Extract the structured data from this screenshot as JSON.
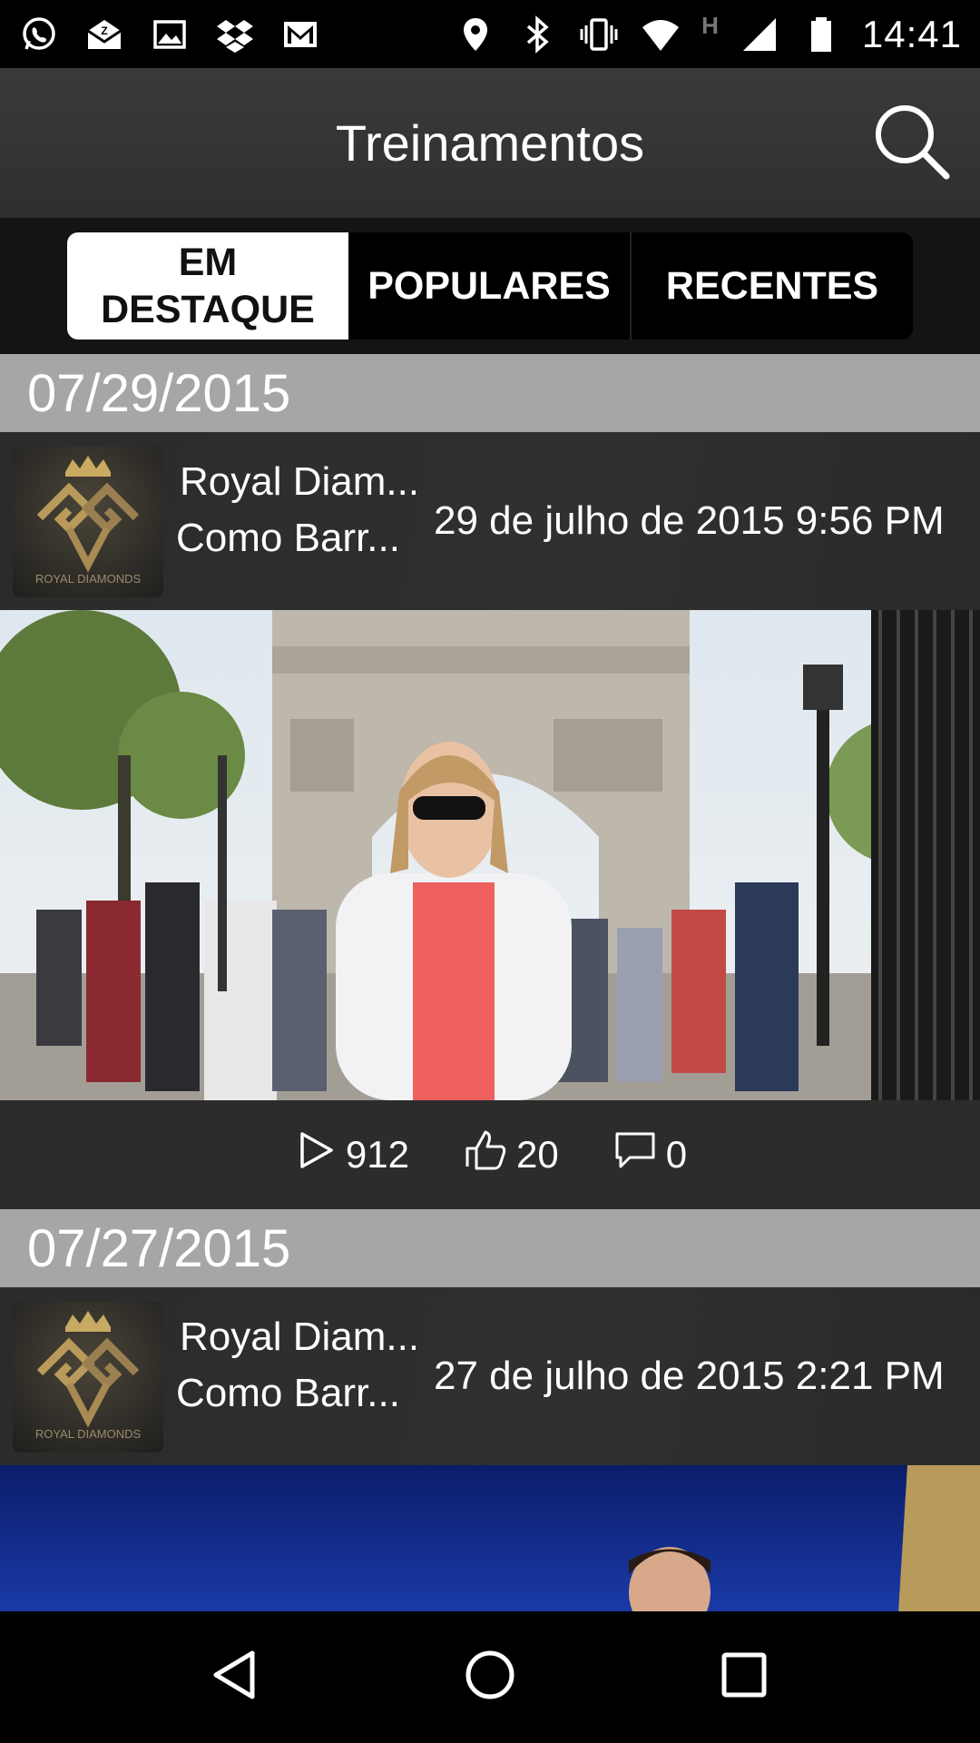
{
  "status_bar": {
    "time": "14:41",
    "left_icons": [
      "whatsapp-icon",
      "mail-open-icon",
      "image-icon",
      "dropbox-icon",
      "gmail-icon"
    ],
    "right_icons": [
      "location-icon",
      "bluetooth-icon",
      "vibrate-icon",
      "wifi-icon",
      "signal-icon",
      "battery-icon"
    ],
    "network_label": "H"
  },
  "app_bar": {
    "title": "Treinamentos"
  },
  "tabs": [
    {
      "label": "EM\nDESTAQUE",
      "active": true
    },
    {
      "label": "POPULARES",
      "active": false
    },
    {
      "label": "RECENTES",
      "active": false
    }
  ],
  "feed": [
    {
      "date_header": "07/29/2015",
      "title": "Royal Diam...",
      "subtitle": "Como Barr...",
      "timestamp": "29 de julho de 2015 9:56 PM",
      "thumbnail_label": "ROYAL DIAMONDS",
      "stats": {
        "plays": "912",
        "likes": "20",
        "comments": "0"
      }
    },
    {
      "date_header": "07/27/2015",
      "title": "Royal Diam...",
      "subtitle": "Como Barr...",
      "timestamp": "27 de julho de 2015 2:21 PM",
      "thumbnail_label": "ROYAL DIAMONDS"
    }
  ],
  "colors": {
    "app_bar_bg": "#333333",
    "date_header_bg": "#a6a6a6",
    "tab_active_bg": "#ffffff",
    "tab_bg": "#000000"
  }
}
